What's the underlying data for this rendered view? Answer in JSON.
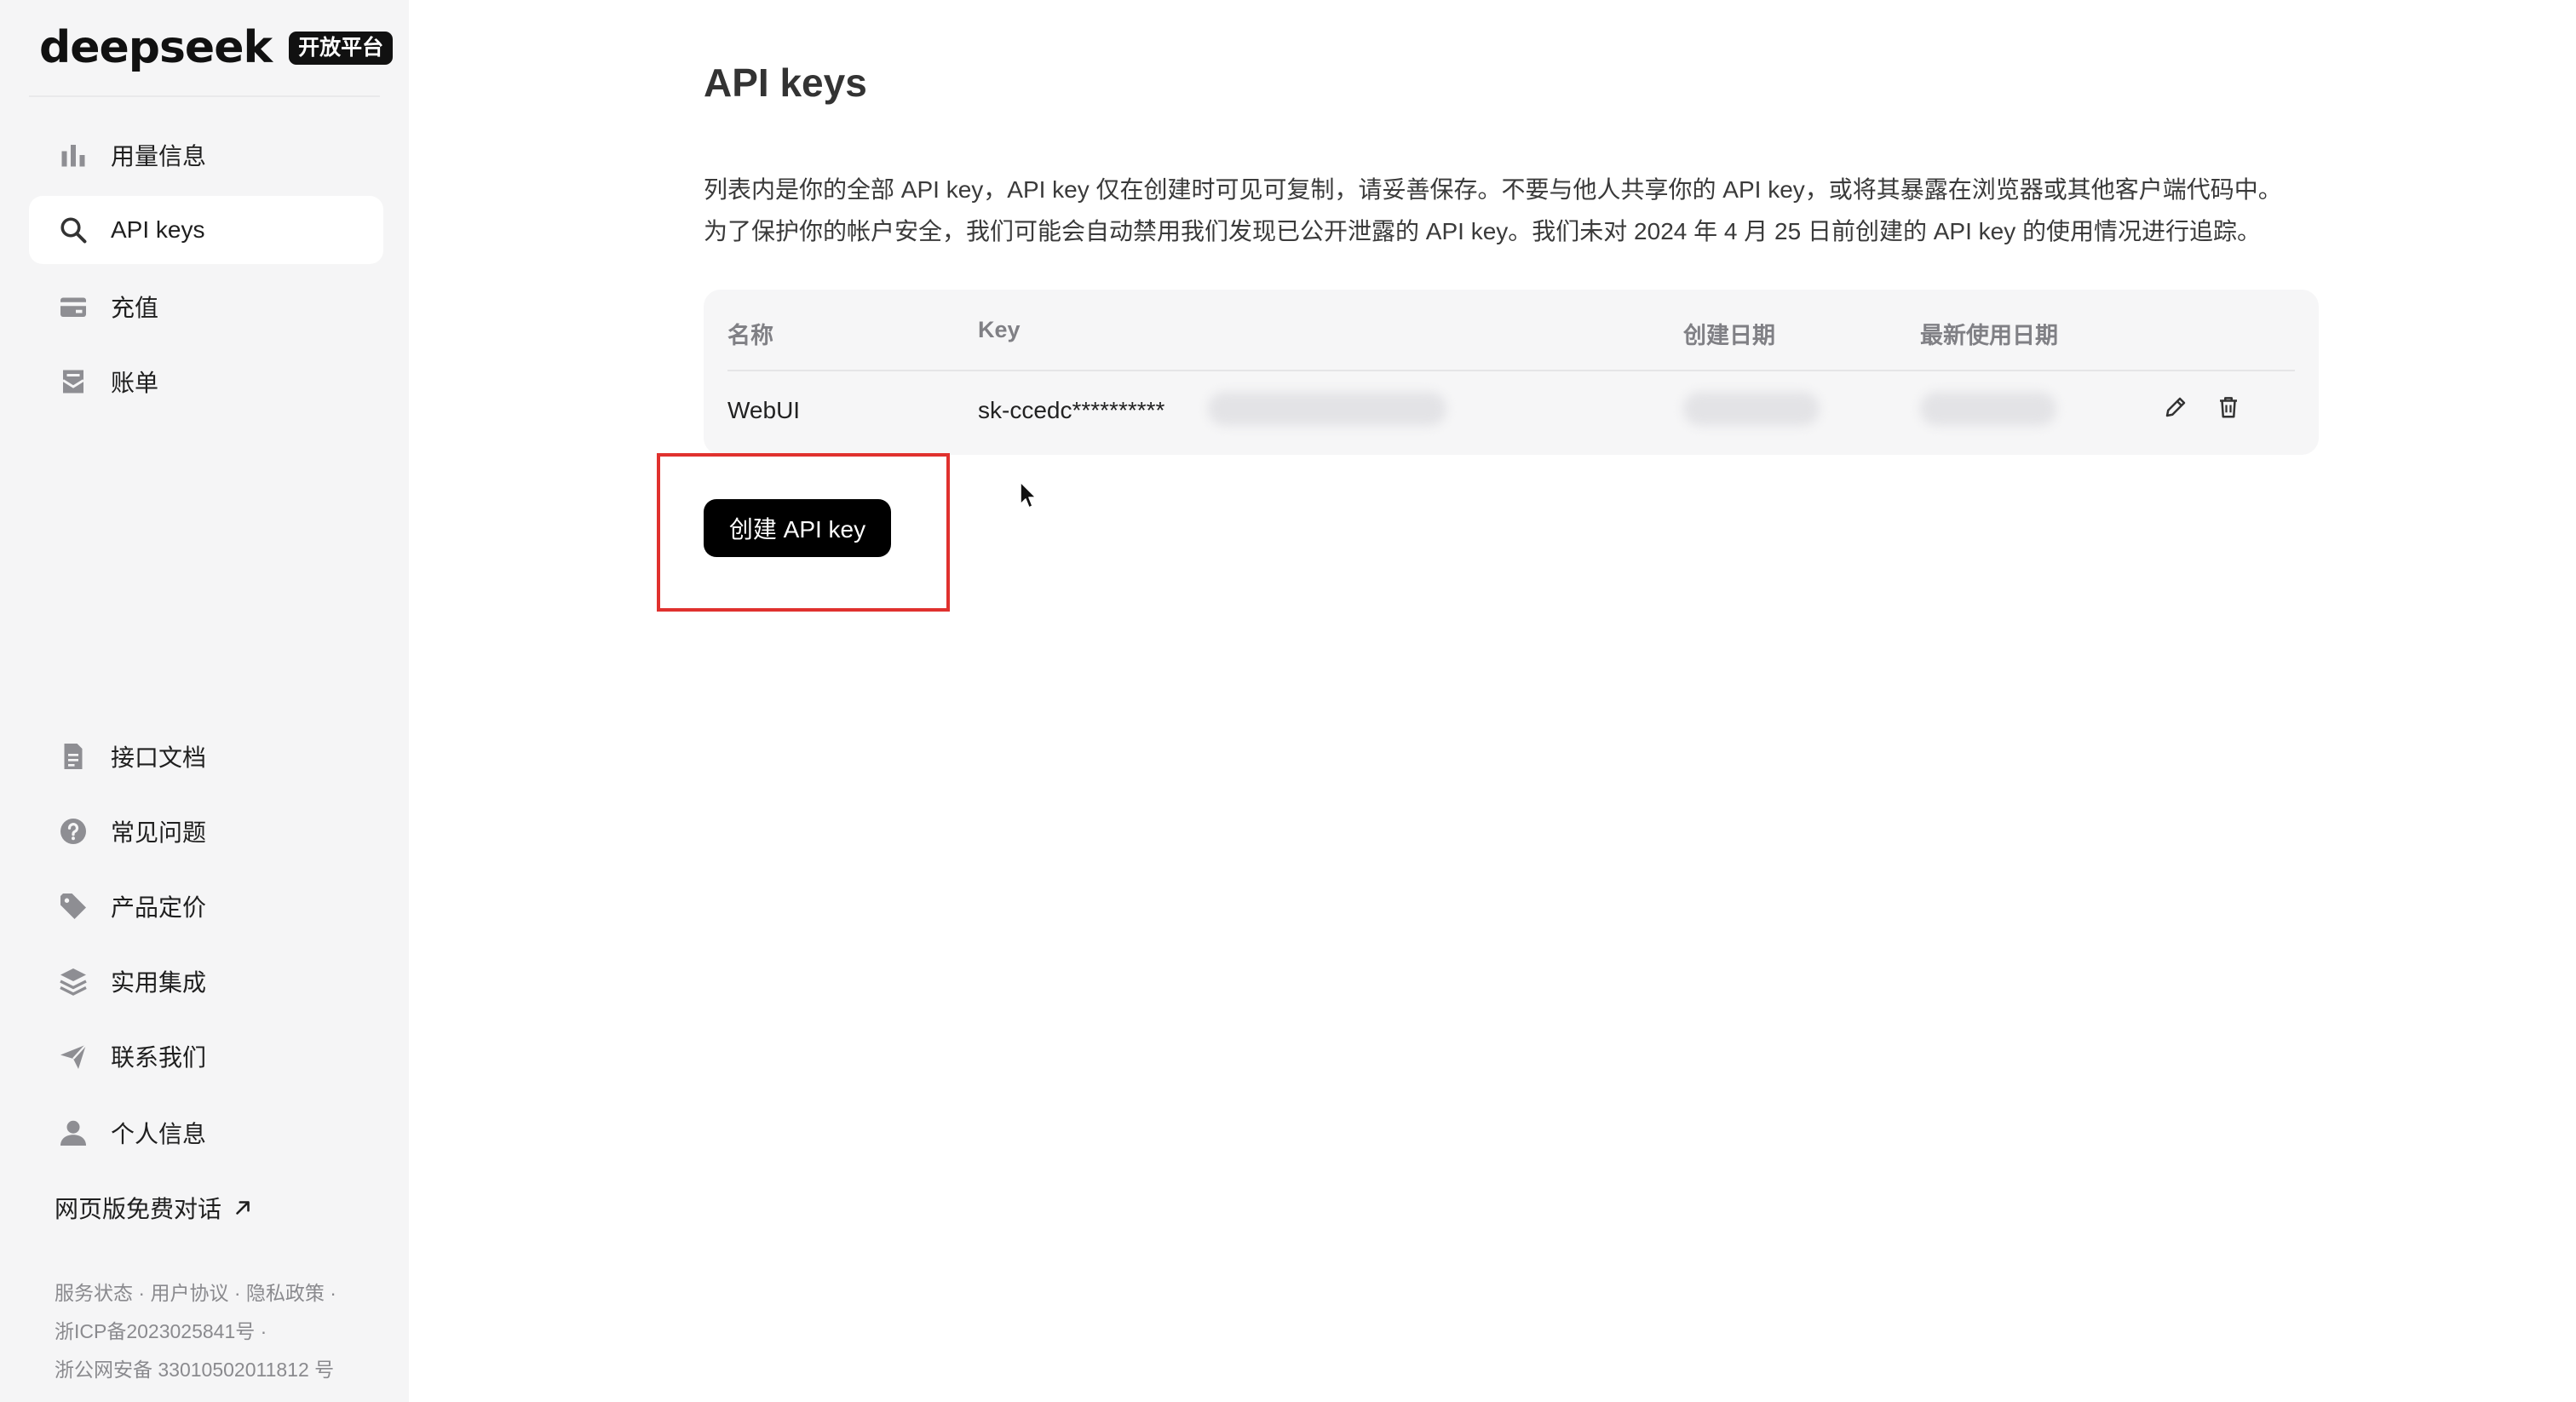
{
  "brand": {
    "logo_text": "deepseek",
    "badge": "开放平台"
  },
  "sidebar": {
    "items": [
      {
        "label": "用量信息",
        "icon": "bar-chart-icon",
        "active": false
      },
      {
        "label": "API keys",
        "icon": "search-icon",
        "active": true
      },
      {
        "label": "充值",
        "icon": "wallet-icon",
        "active": false
      },
      {
        "label": "账单",
        "icon": "bill-icon",
        "active": false
      }
    ],
    "bottom_items": [
      {
        "label": "接口文档",
        "icon": "document-icon"
      },
      {
        "label": "常见问题",
        "icon": "question-icon"
      },
      {
        "label": "产品定价",
        "icon": "tag-icon"
      },
      {
        "label": "实用集成",
        "icon": "layers-icon"
      },
      {
        "label": "联系我们",
        "icon": "send-icon"
      },
      {
        "label": "个人信息",
        "icon": "user-icon"
      }
    ],
    "web_chat": "网页版免费对话",
    "footer": {
      "service_status": "服务状态",
      "user_agreement": "用户协议",
      "privacy_policy": "隐私政策",
      "icp": "浙ICP备2023025841号",
      "police": "浙公网安备 33010502011812 号"
    }
  },
  "main": {
    "title": "API keys",
    "description_line1": "列表内是你的全部 API key，API key 仅在创建时可见可复制，请妥善保存。不要与他人共享你的 API key，或将其暴露在浏览器或其他客户端代码中。",
    "description_line2": "为了保护你的帐户安全，我们可能会自动禁用我们发现已公开泄露的 API key。我们未对 2024 年 4 月 25 日前创建的 API key 的使用情况进行追踪。",
    "table": {
      "headers": {
        "name": "名称",
        "key": "Key",
        "created": "创建日期",
        "last_used": "最新使用日期"
      },
      "rows": [
        {
          "name": "WebUI",
          "key": "sk-ccedc**********"
        }
      ]
    },
    "create_button": "创建 API key"
  },
  "colors": {
    "highlight": "#e0312e",
    "button_bg": "#000000",
    "sidebar_bg": "#f5f5f6"
  }
}
